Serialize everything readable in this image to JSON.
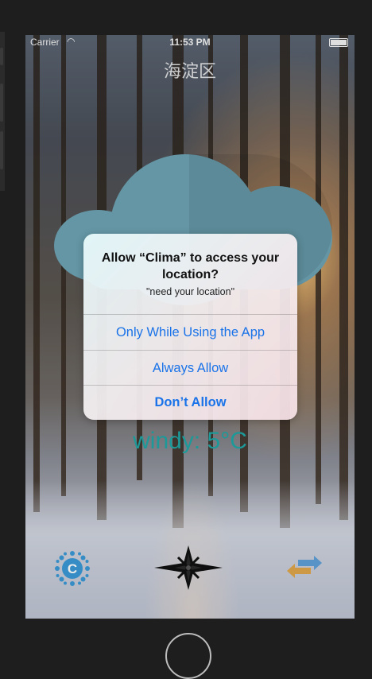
{
  "status_bar": {
    "carrier": "Carrier",
    "time": "11:53 PM"
  },
  "app": {
    "city": "海淀区",
    "weather_text": "windy: 5°C",
    "cloud_color": "#6da3b3",
    "accent_teal": "#1fa7a5"
  },
  "toolbar": {
    "left_icon": "climate-c-icon",
    "center_icon": "compass-icon",
    "right_icon": "swap-arrows-icon"
  },
  "alert": {
    "title": "Allow “Clima” to access your location?",
    "message": "\"need your location\"",
    "buttons": {
      "only_while_using": "Only While Using the App",
      "always_allow": "Always Allow",
      "dont_allow": "Don’t Allow"
    },
    "button_color": "#1a73e8"
  }
}
